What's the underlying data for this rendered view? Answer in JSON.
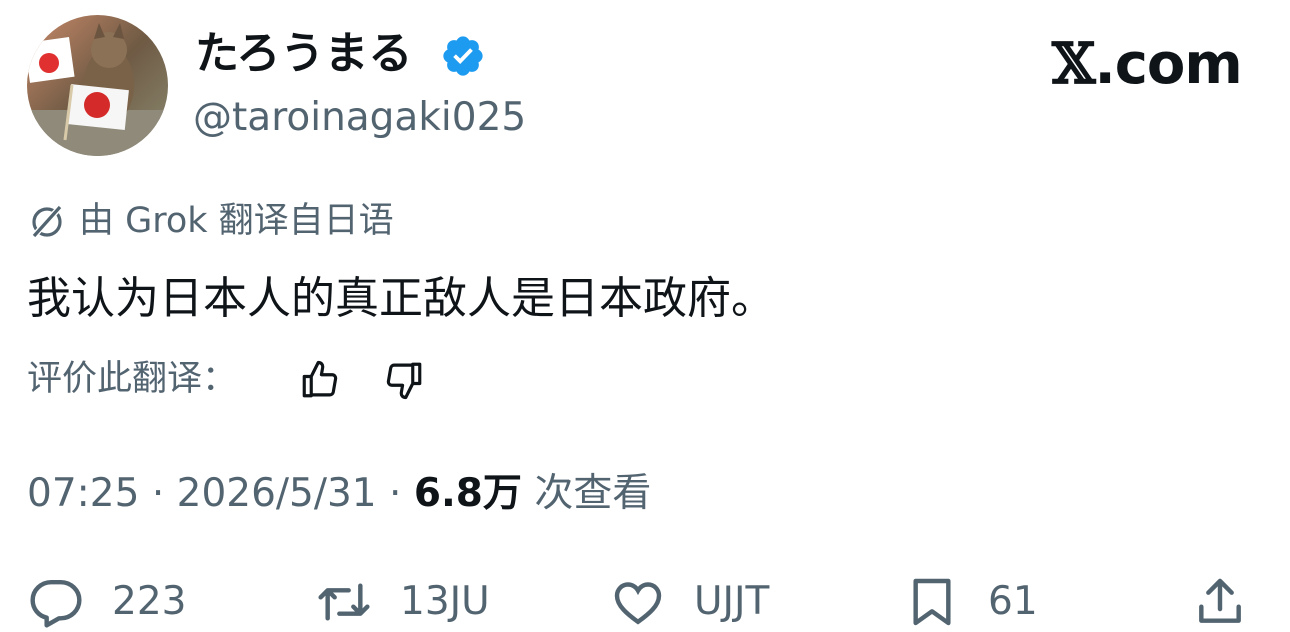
{
  "profile": {
    "display_name": "たろうまる",
    "handle": "@taroinagaki025",
    "verified": true,
    "avatar_icon": "cat-with-japanese-flag-avatar"
  },
  "brand": {
    "label": "𝕏.com",
    "x_glyph": "𝕏",
    "suffix": ".com"
  },
  "translation": {
    "label": "由 Grok 翻译自日语",
    "icon": "grok-icon"
  },
  "tweet": {
    "text": "我认为日本人的真正敌人是日本政府。"
  },
  "rating": {
    "label": "评价此翻译：",
    "thumbs_up_icon": "thumbs-up-icon",
    "thumbs_down_icon": "thumbs-down-icon"
  },
  "meta": {
    "time": "07:25",
    "separator": "·",
    "date": "2026/5/31",
    "views_count": "6.8万",
    "views_label": "次查看"
  },
  "actions": {
    "reply_count": "223",
    "retweet_count": "13JU",
    "like_count": "UJJT",
    "bookmark_count": "61"
  },
  "colors": {
    "text": "#0f1419",
    "secondary": "#536471",
    "verified": "#1d9bf0"
  }
}
